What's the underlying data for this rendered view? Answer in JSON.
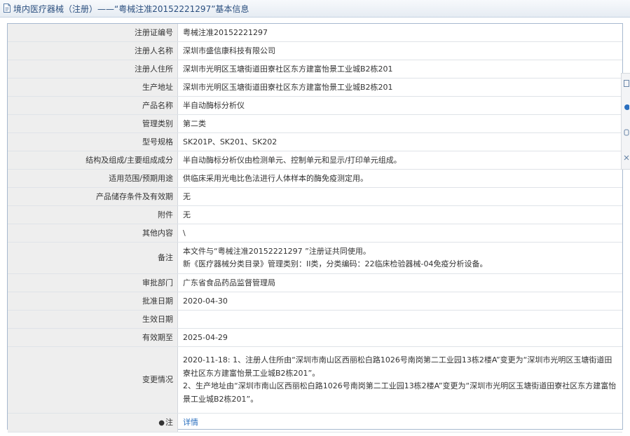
{
  "header": {
    "title": "境内医疗器械（注册）——“粤械注准20152221297”基本信息"
  },
  "rows": [
    {
      "label": "注册证编号",
      "value": "粤械注准20152221297"
    },
    {
      "label": "注册人名称",
      "value": "深圳市盛信康科技有限公司"
    },
    {
      "label": "注册人住所",
      "value": "深圳市光明区玉塘街道田寮社区东方建富怡景工业城B2栋201"
    },
    {
      "label": "生产地址",
      "value": "深圳市光明区玉塘街道田寮社区东方建富怡景工业城B2栋201"
    },
    {
      "label": "产品名称",
      "value": "半自动酶标分析仪"
    },
    {
      "label": "管理类别",
      "value": "第二类"
    },
    {
      "label": "型号规格",
      "value": "SK201P、SK201、SK202"
    },
    {
      "label": "结构及组成/主要组成成分",
      "value": "半自动酶标分析仪由检测单元、控制单元和显示/打印单元组成。"
    },
    {
      "label": "适用范围/预期用途",
      "value": "供临床采用光电比色法进行人体样本的酶免疫测定用。"
    },
    {
      "label": "产品储存条件及有效期",
      "value": "无"
    },
    {
      "label": "附件",
      "value": "无"
    },
    {
      "label": "其他内容",
      "value": "\\"
    },
    {
      "label": "备注",
      "value_line1": "本文件与“粤械注准20152221297 ”注册证共同使用。",
      "value_line2": "新《医疗器械分类目录》管理类别：II类，分类编码：22临床检验器械-04免疫分析设备。"
    },
    {
      "label": "审批部门",
      "value": "广东省食品药品监督管理局"
    },
    {
      "label": "批准日期",
      "value": "2020-04-30"
    },
    {
      "label": "生效日期",
      "value": ""
    },
    {
      "label": "有效期至",
      "value": "2025-04-29"
    },
    {
      "label": "变更情况",
      "value": "2020-11-18: 1、注册人住所由“深圳市南山区西丽松白路1026号南岗第二工业园13栋2楼A”变更为“深圳市光明区玉塘街道田寮社区东方建富怡景工业城B2栋201”。\n2、生产地址由“深圳市南山区西丽松白路1026号南岗第二工业园13栋2楼A”变更为“深圳市光明区玉塘街道田寮社区东方建富怡景工业城B2栋201”。"
    },
    {
      "label": "注",
      "value": "详情"
    }
  ],
  "colors": {
    "label_bg": "#eeeeee",
    "border": "#a7b9cf",
    "title_text": "#2b4f7f",
    "link": "#2a6fbf"
  }
}
